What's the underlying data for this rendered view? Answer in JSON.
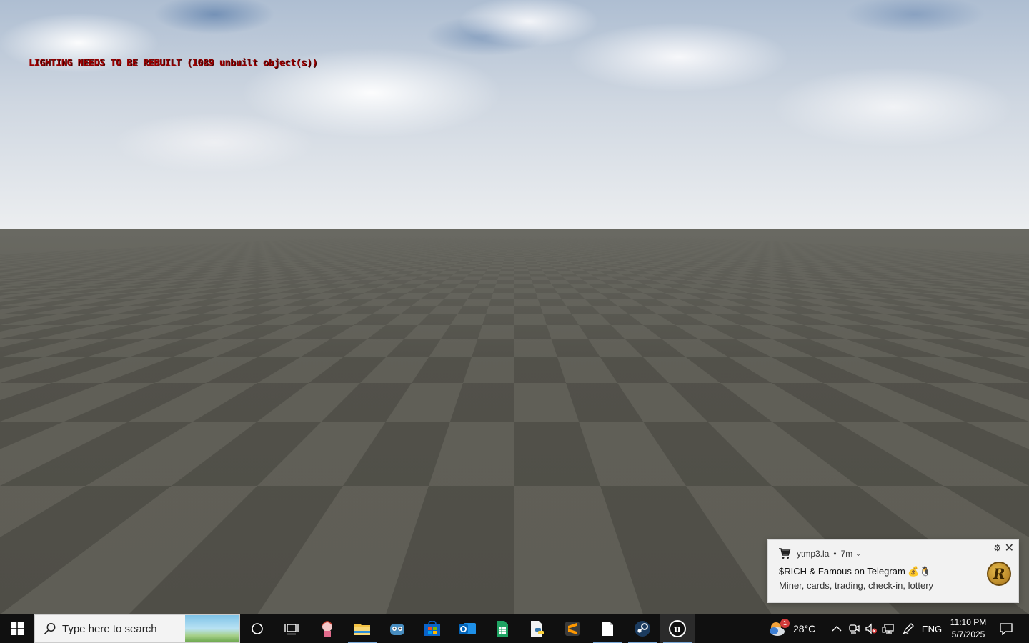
{
  "viewport": {
    "warning": "LIGHTING NEEDS TO BE REBUILT (1089 unbuilt object(s))"
  },
  "toast": {
    "app_name": "ytmp3.la",
    "separator": "•",
    "time_ago": "7m",
    "title": "$RICH & Famous on Telegram 💰🐧",
    "body": "Miner, cards, trading, check-in, lottery",
    "logo_letter": "R"
  },
  "taskbar": {
    "search_placeholder": "Type here to search",
    "apps": [
      {
        "name": "cortana",
        "icon": "circle-icon"
      },
      {
        "name": "task-view",
        "icon": "task-view-icon"
      },
      {
        "name": "anime-app",
        "icon": "character-icon"
      },
      {
        "name": "file-explorer",
        "icon": "folder-icon",
        "running": true
      },
      {
        "name": "godot",
        "icon": "godot-icon"
      },
      {
        "name": "microsoft-store",
        "icon": "store-icon"
      },
      {
        "name": "outlook",
        "icon": "outlook-icon"
      },
      {
        "name": "google-sheets",
        "icon": "sheets-icon"
      },
      {
        "name": "python-file",
        "icon": "python-icon"
      },
      {
        "name": "sublime-text",
        "icon": "sublime-icon"
      },
      {
        "name": "notepad",
        "icon": "document-icon",
        "running": true
      },
      {
        "name": "steam",
        "icon": "steam-icon",
        "running": true
      },
      {
        "name": "unreal-engine",
        "icon": "unreal-icon",
        "running": true,
        "active": true
      }
    ],
    "weather": {
      "temp": "28°C",
      "badge": "1"
    },
    "language": "ENG",
    "time": "11:10 PM",
    "date": "5/7/2025"
  },
  "colors": {
    "warning_text": "#9a0000",
    "taskbar_bg": "#101010",
    "running_indicator": "#7aa9d8"
  }
}
